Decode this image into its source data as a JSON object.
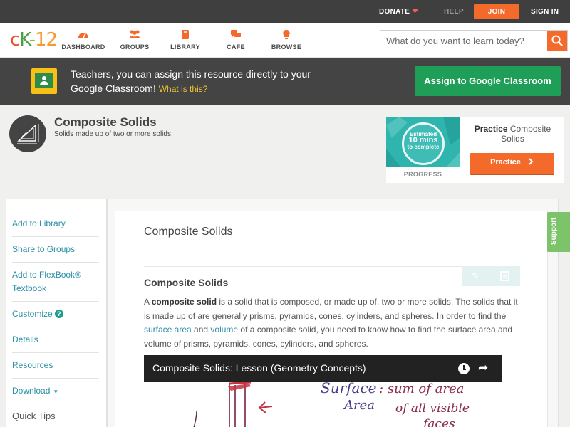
{
  "topbar": {
    "donate": "DONATE",
    "help": "HELP",
    "join": "JOIN",
    "signin": "SIGN IN"
  },
  "nav": {
    "logo": {
      "c": "c",
      "k": "K",
      "dash": "-",
      "num": "12"
    },
    "items": [
      {
        "label": "DASHBOARD",
        "icon": "dashboard-icon"
      },
      {
        "label": "GROUPS",
        "icon": "groups-icon"
      },
      {
        "label": "LIBRARY",
        "icon": "library-icon"
      },
      {
        "label": "CAFE",
        "icon": "cafe-icon"
      },
      {
        "label": "BROWSE",
        "icon": "browse-icon"
      }
    ],
    "search_placeholder": "What do you want to learn today?"
  },
  "banner": {
    "message": "Teachers, you can assign this resource directly to your Google Classroom!",
    "what_link": "What is this?",
    "assign_button": "Assign to Google Classroom"
  },
  "concept": {
    "title": "Composite Solids",
    "subtitle": "Solids made up of two or more solids."
  },
  "practice": {
    "estimated": "Estimated",
    "mins": "10 mins",
    "to_complete": "to complete",
    "progress_label": "PROGRESS",
    "title_bold": "Practice",
    "title_rest": "Composite Solids",
    "button": "Practice"
  },
  "sidebar": {
    "items": [
      {
        "label": "Add to Library"
      },
      {
        "label": "Share to Groups"
      },
      {
        "label": "Add to FlexBook® Textbook"
      },
      {
        "label": "Customize"
      },
      {
        "label": "Details"
      },
      {
        "label": "Resources"
      },
      {
        "label": "Download"
      }
    ],
    "customize_help": "?",
    "quick_tips": "Quick Tips"
  },
  "content": {
    "title": "Composite Solids",
    "section_title": "Composite Solids",
    "para": {
      "p1": "A ",
      "bold": "composite solid",
      "p2": " is a solid that is composed, or made up of, two or more solids. The solids that it is made up of are generally prisms, pyramids, cones, cylinders, and spheres. In order to find the ",
      "link1": "surface area",
      "p3": " and ",
      "link2": "volume",
      "p4": " of a composite solid, you need to know how to find the surface area and volume of prisms, pyramids, cones, cylinders, and spheres."
    },
    "video_title": "Composite Solids: Lesson (Geometry Concepts)",
    "whiteboard": {
      "line1a": "Surface",
      "line1b": ": sum of area",
      "line2a": "Area",
      "line2b": "of all visible",
      "line3": "faces"
    }
  },
  "support": "Support",
  "colors": {
    "accent": "#f36a2a",
    "link": "#2b8fa6",
    "green": "#1f9e58",
    "teal": "#2fb4ae"
  }
}
